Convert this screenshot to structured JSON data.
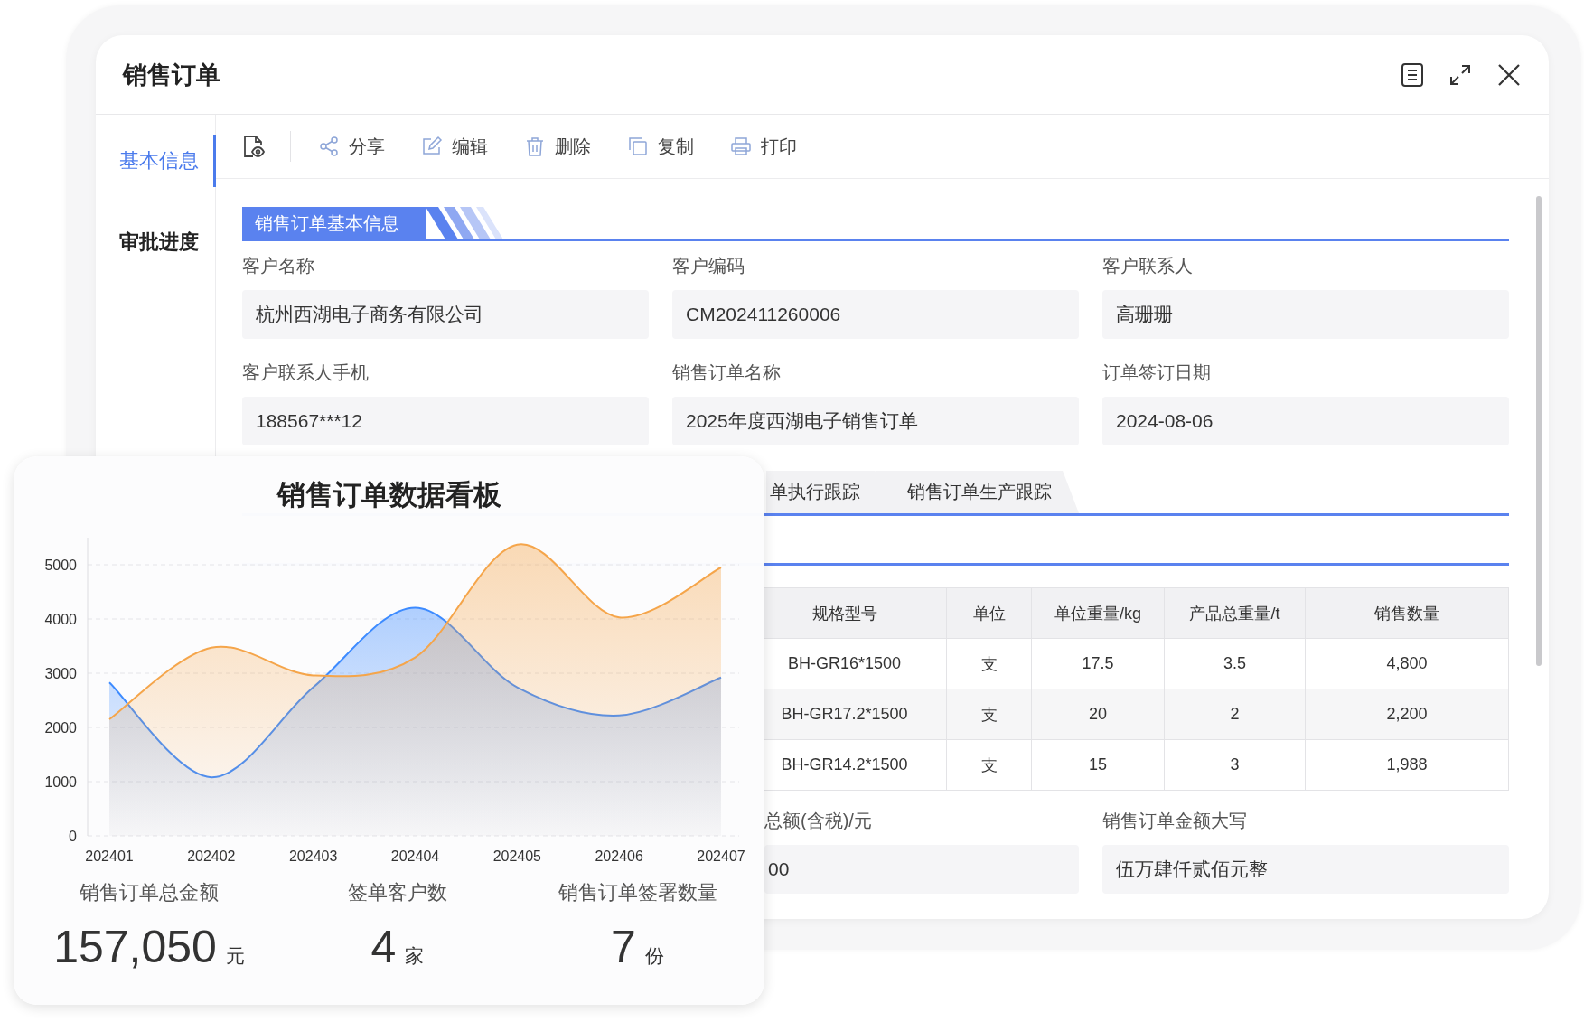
{
  "window": {
    "title": "销售订单"
  },
  "sidebar": {
    "items": [
      {
        "label": "基本信息",
        "selected": true
      },
      {
        "label": "审批进度",
        "selected": false
      }
    ]
  },
  "toolbar": {
    "actions": [
      "分享",
      "编辑",
      "删除",
      "复制",
      "打印"
    ]
  },
  "section": {
    "title": "销售订单基本信息"
  },
  "fields": [
    {
      "label": "客户名称",
      "value": "杭州西湖电子商务有限公司"
    },
    {
      "label": "客户编码",
      "value": "CM202411260006"
    },
    {
      "label": "客户联系人",
      "value": "高珊珊"
    },
    {
      "label": "客户联系人手机",
      "value": "188567***12"
    },
    {
      "label": "销售订单名称",
      "value": "2025年度西湖电子销售订单"
    },
    {
      "label": "订单签订日期",
      "value": "2024-08-06"
    }
  ],
  "tabs": [
    {
      "label": "单执行跟踪",
      "selected": false
    },
    {
      "label": "销售订单生产跟踪",
      "selected": false
    }
  ],
  "table": {
    "columns": [
      "规格型号",
      "单位",
      "单位重量/kg",
      "产品总重量/t",
      "销售数量"
    ],
    "rows": [
      [
        "BH-GR16*1500",
        "支",
        "17.5",
        "3.5",
        "4,800"
      ],
      [
        "BH-GR17.2*1500",
        "支",
        "20",
        "2",
        "2,200"
      ],
      [
        "BH-GR14.2*1500",
        "支",
        "15",
        "3",
        "1,988"
      ]
    ]
  },
  "bottom_fields": [
    {
      "label": "总额(含税)/元",
      "value": "00"
    },
    {
      "label": "销售订单金额大写",
      "value": "伍万肆仟贰佰元整"
    }
  ],
  "dashboard": {
    "title": "销售订单数据看板",
    "chart_data": {
      "type": "area",
      "categories": [
        "202401",
        "202402",
        "202403",
        "202404",
        "202405",
        "202406",
        "202407"
      ],
      "series": [
        {
          "color": "#3d8bff",
          "values": [
            2830,
            1080,
            2740,
            4210,
            2740,
            2220,
            2920
          ]
        },
        {
          "color": "#f5a54a",
          "values": [
            2150,
            3470,
            2960,
            3290,
            5370,
            4030,
            4950
          ]
        }
      ],
      "ylim": [
        0,
        5500
      ],
      "yticks": [
        0,
        1000,
        2000,
        3000,
        4000,
        5000
      ],
      "grid": true
    },
    "stats": [
      {
        "label": "销售订单总金额",
        "value": "157,050",
        "unit": "元"
      },
      {
        "label": "签单客户数",
        "value": "4",
        "unit": "家"
      },
      {
        "label": "销售订单签署数量",
        "value": "7",
        "unit": "份"
      }
    ]
  }
}
